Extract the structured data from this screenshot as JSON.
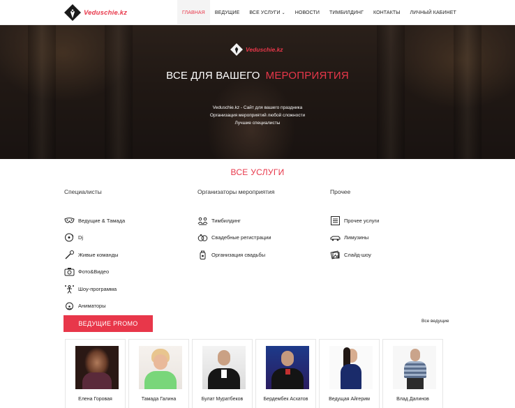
{
  "header": {
    "logo_text": "Veduschie.kz",
    "nav": [
      {
        "label": "ГЛАВНАЯ",
        "active": true
      },
      {
        "label": "ВЕДУЩИЕ"
      },
      {
        "label": "ВСЕ УСЛУГИ",
        "dropdown": true
      },
      {
        "label": "НОВОСТИ"
      },
      {
        "label": "ТИМБИЛДИНГ"
      },
      {
        "label": "КОНТАКТЫ"
      },
      {
        "label": "ЛИЧНЫЙ КАБИНЕТ"
      }
    ]
  },
  "hero": {
    "logo_text": "Veduschie.kz",
    "title_main": "ВСЕ ДЛЯ ВАШЕГО",
    "title_accent": "МЕРОПРИЯТИЯ",
    "line1": "Veduschie.kz - Сайт для вашего праздника",
    "line2": "Организация мероприятий любой сложности",
    "line3": "Лучшие специалисты"
  },
  "services": {
    "title": "ВСЕ УСЛУГИ",
    "columns": [
      {
        "title": "Специалисты",
        "items": [
          {
            "label": "Ведущие & Тамада",
            "icon": "mask-icon"
          },
          {
            "label": "Dj",
            "icon": "vinyl-icon"
          },
          {
            "label": "Живые команды",
            "icon": "microphone-icon"
          },
          {
            "label": "Фото&Видео",
            "icon": "camera-icon"
          },
          {
            "label": "Шоу-программа",
            "icon": "juggler-icon"
          },
          {
            "label": "Аниматоры",
            "icon": "clown-icon"
          }
        ]
      },
      {
        "title": "Организаторы мероприятия",
        "items": [
          {
            "label": "Тимбилдинг",
            "icon": "team-icon"
          },
          {
            "label": "Свадебные регистрации",
            "icon": "rings-icon"
          },
          {
            "label": "Организация свадьбы",
            "icon": "bottle-icon"
          }
        ]
      },
      {
        "title": "Прочее",
        "items": [
          {
            "label": "Прочее услуги",
            "icon": "list-icon"
          },
          {
            "label": "Лимузины",
            "icon": "limousine-icon"
          },
          {
            "label": "Слайд-шоу",
            "icon": "slides-icon"
          }
        ]
      }
    ]
  },
  "promo": {
    "button_label": "ВЕДУЩИЕ PROMO",
    "all_link": "Все ведущие",
    "cards": [
      {
        "name": "Елена Горовая"
      },
      {
        "name": "Тамада Галина"
      },
      {
        "name": "Булат Муратбеков"
      },
      {
        "name": "Бердембек Асхатов"
      },
      {
        "name": "Ведущая Айгерим"
      },
      {
        "name": "Влад Далинов"
      }
    ]
  },
  "colors": {
    "accent": "#e8374a"
  }
}
